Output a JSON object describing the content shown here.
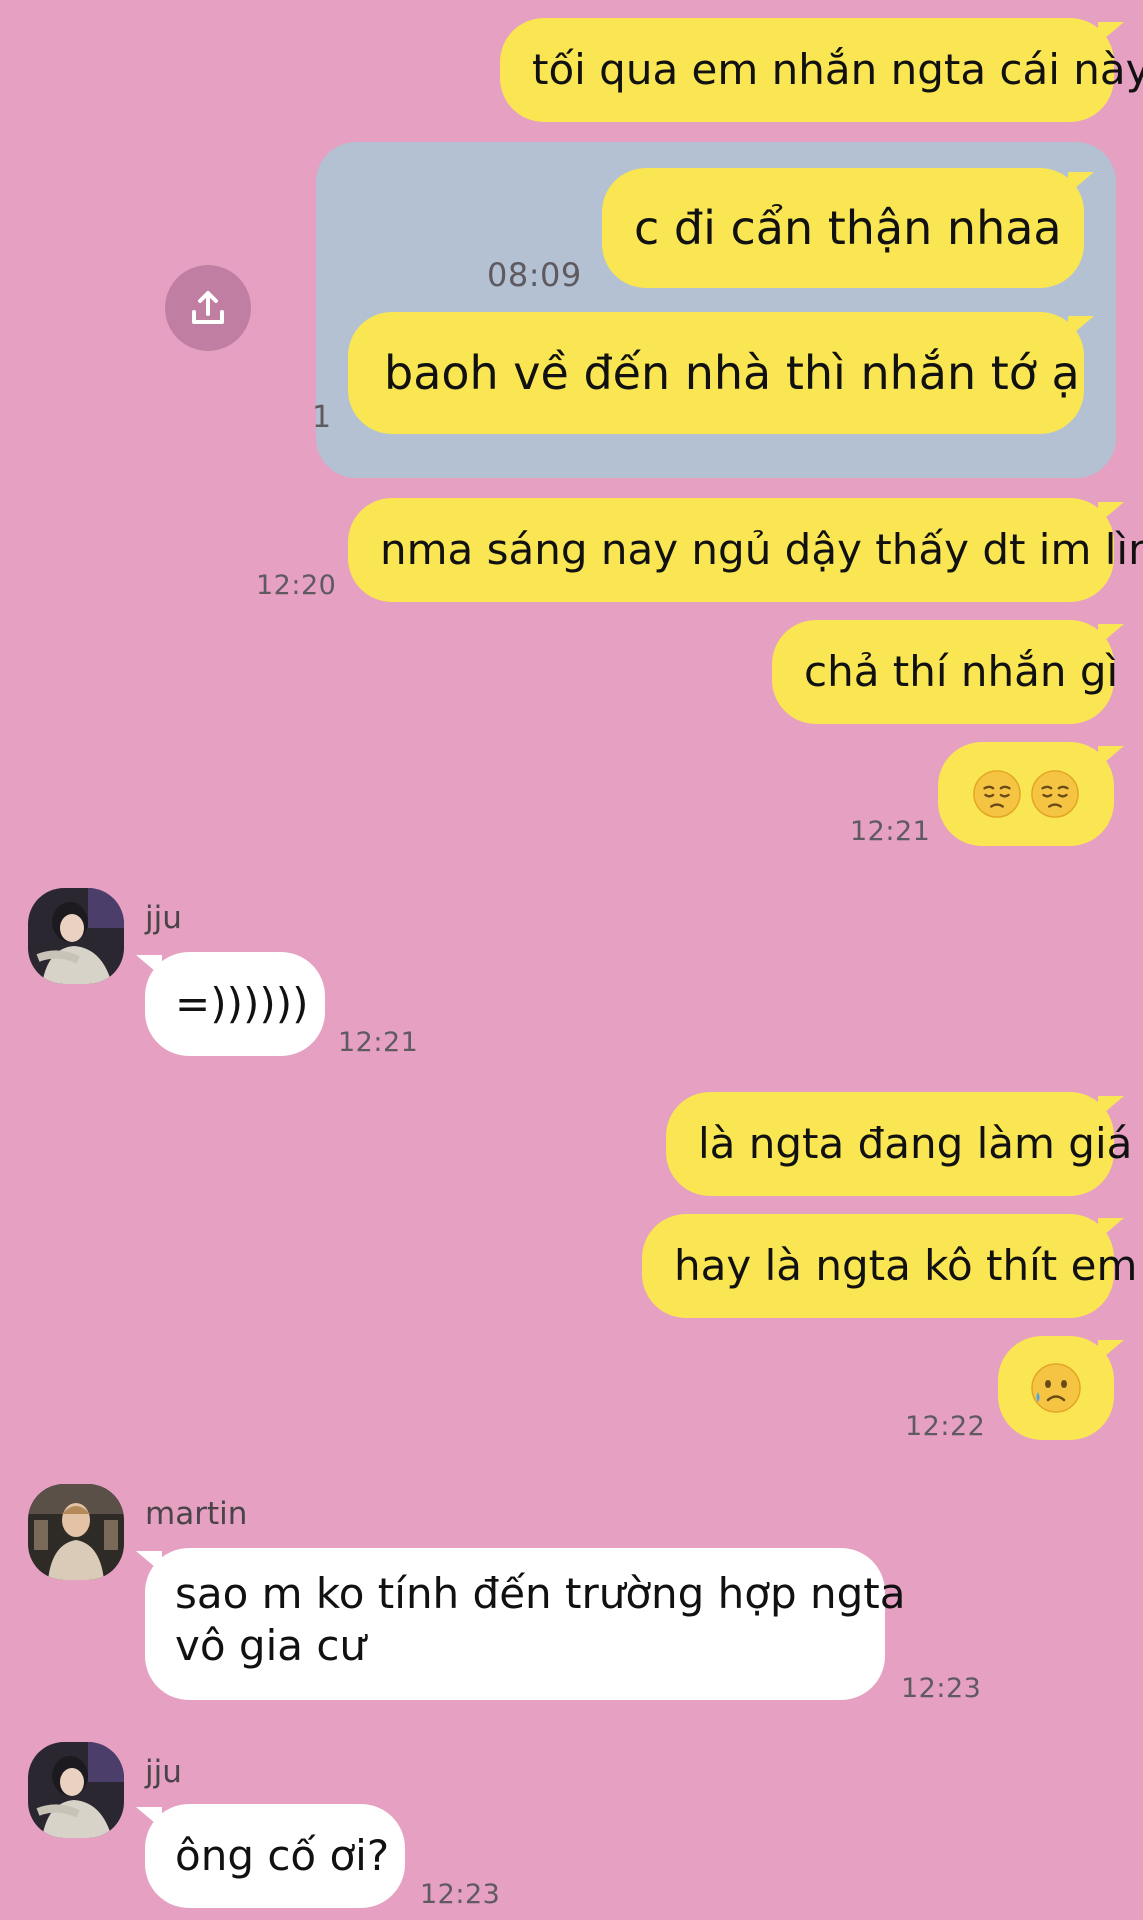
{
  "colors": {
    "background": "#e5a0c2",
    "my_bubble": "#f9e652",
    "their_bubble": "#ffffff",
    "quoted_panel": "#b3c1d3"
  },
  "messages": {
    "m1": "tối qua em nhắn ngta cái này",
    "quoted": {
      "line1": "c đi cẩn thận nhaa",
      "time": "08:09",
      "line2": "baoh về đến nhà thì nhắn tớ ạ",
      "read_count": "1"
    },
    "m2": "nma sáng nay ngủ dậy thấy dt im lìm",
    "m2_time": "12:20",
    "m3": "chả thí nhắn gì",
    "m4_time": "12:21",
    "m4_emoji": [
      "pensive-face-icon",
      "pensive-face-icon"
    ],
    "reply1_name": "jju",
    "reply1_text": "=))))))",
    "reply1_time": "12:21",
    "m5": "là ngta đang làm giá",
    "m6": "hay là ngta kô thít em",
    "m7_emoji": "sad-sweat-face-icon",
    "m7_time": "12:22",
    "reply2_name": "martin",
    "reply2_line1": "sao m ko tính đến trường hợp ngta",
    "reply2_line2": "vô gia cư",
    "reply2_time": "12:23",
    "reply3_name": "jju",
    "reply3_text": "ông cố ơi?",
    "reply3_time": "12:23"
  },
  "icons": {
    "share": "share-upload-icon"
  }
}
